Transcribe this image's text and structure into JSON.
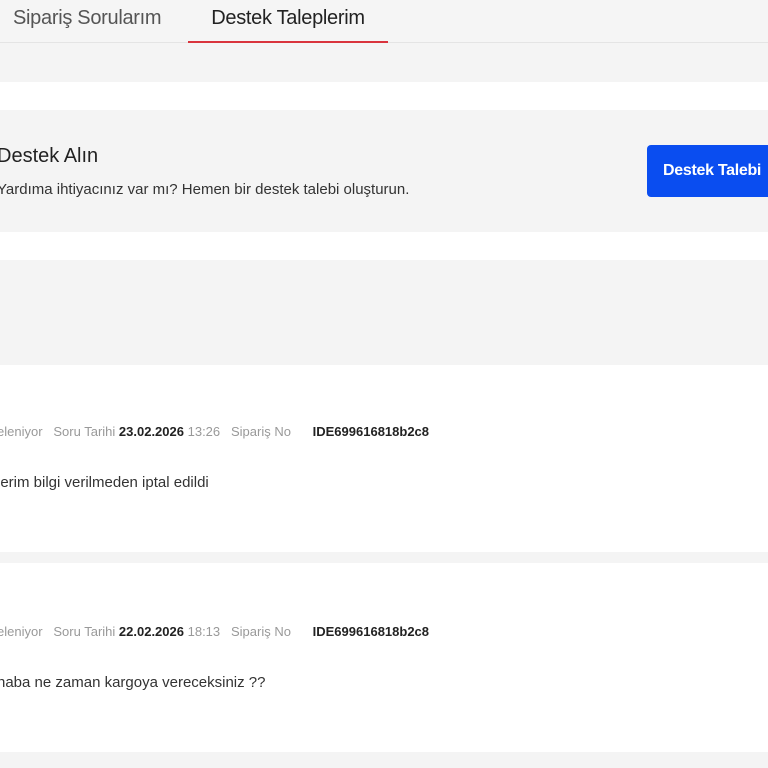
{
  "tabs": [
    {
      "label": "Sipariş Sorularım",
      "active": false
    },
    {
      "label": "Destek Taleplerim",
      "active": true
    }
  ],
  "support": {
    "title": "Destek Alın",
    "subtitle": "Yardıma ihtiyacınız var mı? Hemen bir destek talebi oluşturun.",
    "button": "Destek Talebi"
  },
  "accent": "#d9343d",
  "button_color": "#0a4df0",
  "tickets": [
    {
      "status": "eleniyor",
      "date_label": "Soru Tarihi",
      "date": "23.02.2026",
      "time": "13:26",
      "order_label": "Sipariş No",
      "order_no": "IDE699616818b2c8",
      "message": "lerim bilgi verilmeden iptal edildi"
    },
    {
      "status": "eleniyor",
      "date_label": "Soru Tarihi",
      "date": "22.02.2026",
      "time": "18:13",
      "order_label": "Sipariş No",
      "order_no": "IDE699616818b2c8",
      "message": "haba ne zaman kargoya vereceksiniz ??"
    }
  ]
}
